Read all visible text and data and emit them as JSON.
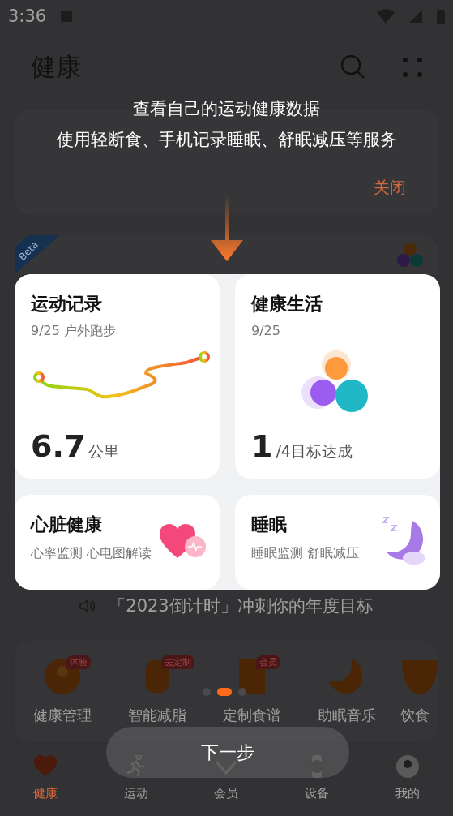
{
  "status_bar": {
    "time": "3:36"
  },
  "header": {
    "title": "健康"
  },
  "banner": {
    "close": "关闭"
  },
  "hidden_card": {
    "badge": "Beta"
  },
  "guide": {
    "lines": [
      "查看自己的运动健康数据",
      "使用轻断食、手机记录睡眠、舒眠减压等服务"
    ],
    "pages": [
      {
        "selected": false
      },
      {
        "selected": true
      },
      {
        "selected": false
      }
    ],
    "next_button": "下一步"
  },
  "cards": [
    {
      "kind": "route",
      "title": "运动记录",
      "subtitle": "9/25 户外跑步",
      "value": "6.7",
      "unit": "公里"
    },
    {
      "kind": "goals",
      "title": "健康生活",
      "subtitle": "9/25",
      "value": "1",
      "unit": "/4目标达成"
    },
    {
      "kind": "heart",
      "title": "心脏健康",
      "subtitle": "心率监测 心电图解读"
    },
    {
      "kind": "sleep",
      "title": "睡眠",
      "subtitle": "睡眠监测 舒眠减压"
    }
  ],
  "announcement": "「2023倒计时」冲刺你的年度目标",
  "services": [
    {
      "kind": "person",
      "label": "健康管理",
      "badge": "体验"
    },
    {
      "kind": "body",
      "label": "智能减脂",
      "badge": "去定制"
    },
    {
      "kind": "book",
      "label": "定制食谱",
      "badge": "会员"
    },
    {
      "kind": "moon",
      "label": "助眠音乐"
    },
    {
      "kind": "bowl",
      "label": "饮食"
    }
  ],
  "nav": [
    {
      "kind": "heart",
      "label": "健康",
      "selected": true
    },
    {
      "kind": "run",
      "label": "运动",
      "selected": false
    },
    {
      "kind": "vip",
      "label": "会员",
      "selected": false
    },
    {
      "kind": "watch",
      "label": "设备",
      "selected": false
    },
    {
      "kind": "me",
      "label": "我的",
      "selected": false
    }
  ]
}
